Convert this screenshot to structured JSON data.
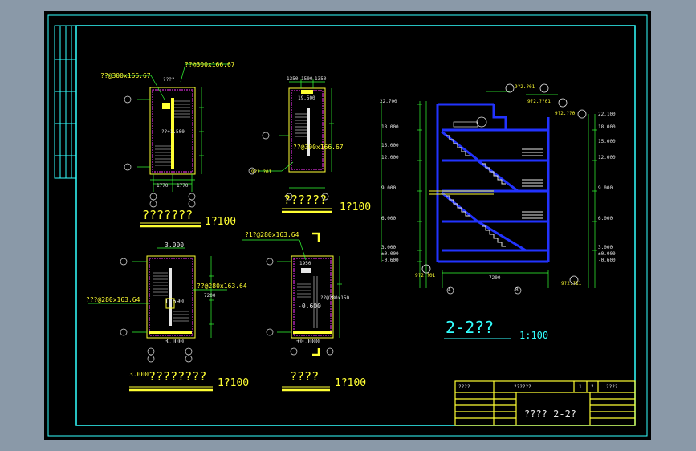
{
  "colors": {
    "background": "#8a99a8",
    "sheet": "#000000",
    "frame": "#33ffff",
    "title_block": "#ffff33",
    "stair": "#2233ff",
    "dim": "#33ff33",
    "text": "#e6e6e6"
  },
  "plans": {
    "p1": {
      "title": "???????",
      "scale": "1?100",
      "note_a": "??@300x166.67",
      "note_b": "??@300x166.67",
      "inner": "????",
      "level": "??+1.500",
      "dim_left": "1770",
      "dim_right": "1770"
    },
    "p2": {
      "title": "??????",
      "scale": "1?100",
      "top_dims": [
        "1350",
        "1500",
        "1350"
      ],
      "level": "19.500",
      "note": "??@300x166.67",
      "tag": "9?2.?01"
    },
    "p3": {
      "title": "????????",
      "scale": "1?100",
      "prefix": "3.000",
      "level_top": "3.000",
      "level_mid": "1.690",
      "level_bot": "3.000",
      "note_a": "???@280x163.64",
      "note_b": "??@280x163.64",
      "side": "7200"
    },
    "p4": {
      "title": "????",
      "scale": "1?100",
      "note_top": "?1?@280x163.64",
      "inner": "1950",
      "level_a": "-0.600",
      "level_b": "±0.000",
      "note_side": "??@280x150"
    }
  },
  "section": {
    "title": "2-2??",
    "scale": "1:100",
    "tag_top": "9?2.?01",
    "tag_top2": "9?2.??01",
    "tag_right": "9?2.??0",
    "tag_bottom": "9?2.?11",
    "tag_left_bottom": "9?2.?01",
    "axis_left": "A",
    "axis_right": "B",
    "span": "7200",
    "levels_left": [
      "22.700",
      "18.000",
      "15.000",
      "12.000",
      "9.000",
      "6.000",
      "3.000",
      "±0.000",
      "-0.600"
    ],
    "levels_right": [
      "22.100",
      "18.000",
      "15.000",
      "12.000",
      "9.000",
      "6.000",
      "3.000",
      "±0.000",
      "-0.600"
    ]
  },
  "title_block": {
    "cell_a": "????",
    "cell_b": "??????",
    "cell_c": "1",
    "cell_d": "?",
    "cell_e": "????",
    "drawing": "???? 2-2?"
  }
}
